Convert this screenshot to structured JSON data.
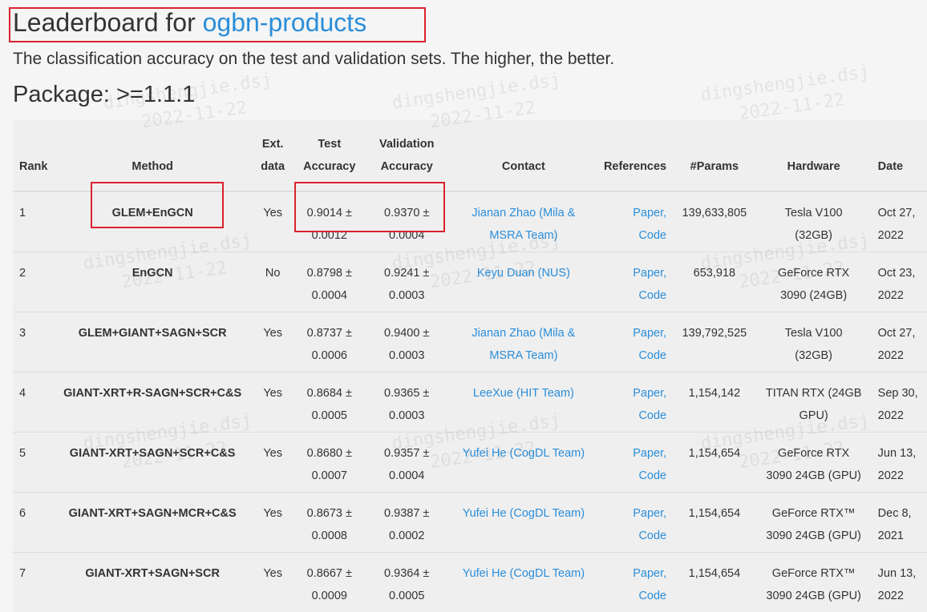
{
  "header": {
    "title_prefix": "Leaderboard for ",
    "title_link": "ogbn-products",
    "subtitle": "The classification accuracy on the test and validation sets. The higher, the better.",
    "package": "Package: >=1.1.1"
  },
  "watermark": {
    "line1": "dingshengjie.dsj",
    "line2": "2022-11-22"
  },
  "table": {
    "columns": {
      "rank": "Rank",
      "method": "Method",
      "ext_line1": "Ext.",
      "ext_line2": "data",
      "test_line1": "Test",
      "test_line2": "Accuracy",
      "val_line1": "Validation",
      "val_line2": "Accuracy",
      "contact": "Contact",
      "references": "References",
      "params": "#Params",
      "hardware": "Hardware",
      "date": "Date"
    },
    "rows": [
      {
        "rank": "1",
        "method": "GLEM+EnGCN",
        "ext": "Yes",
        "test_a": "0.9014 ±",
        "test_b": "0.0012",
        "val_a": "0.9370 ±",
        "val_b": "0.0004",
        "contact_a": "Jianan Zhao (Mila &",
        "contact_b": "MSRA Team)",
        "ref_paper": "Paper,",
        "ref_code": "Code",
        "params": "139,633,805",
        "hw_a": "Tesla V100",
        "hw_b": "(32GB)",
        "date_a": "Oct 27,",
        "date_b": "2022"
      },
      {
        "rank": "2",
        "method": "EnGCN",
        "ext": "No",
        "test_a": "0.8798 ±",
        "test_b": "0.0004",
        "val_a": "0.9241 ±",
        "val_b": "0.0003",
        "contact_a": "Keyu Duan (NUS)",
        "contact_b": "",
        "ref_paper": "Paper,",
        "ref_code": "Code",
        "params": "653,918",
        "hw_a": "GeForce RTX",
        "hw_b": "3090 (24GB)",
        "date_a": "Oct 23,",
        "date_b": "2022"
      },
      {
        "rank": "3",
        "method": "GLEM+GIANT+SAGN+SCR",
        "ext": "Yes",
        "test_a": "0.8737 ±",
        "test_b": "0.0006",
        "val_a": "0.9400 ±",
        "val_b": "0.0003",
        "contact_a": "Jianan Zhao (Mila &",
        "contact_b": "MSRA Team)",
        "ref_paper": "Paper,",
        "ref_code": "Code",
        "params": "139,792,525",
        "hw_a": "Tesla V100",
        "hw_b": "(32GB)",
        "date_a": "Oct 27,",
        "date_b": "2022"
      },
      {
        "rank": "4",
        "method": "GIANT-XRT+R-SAGN+SCR+C&S",
        "ext": "Yes",
        "test_a": "0.8684 ±",
        "test_b": "0.0005",
        "val_a": "0.9365 ±",
        "val_b": "0.0003",
        "contact_a": "LeeXue (HIT Team)",
        "contact_b": "",
        "ref_paper": "Paper,",
        "ref_code": "Code",
        "params": "1,154,142",
        "hw_a": "TITAN RTX (24GB",
        "hw_b": "GPU)",
        "date_a": "Sep 30,",
        "date_b": "2022"
      },
      {
        "rank": "5",
        "method": "GIANT-XRT+SAGN+SCR+C&S",
        "ext": "Yes",
        "test_a": "0.8680 ±",
        "test_b": "0.0007",
        "val_a": "0.9357 ±",
        "val_b": "0.0004",
        "contact_a": "Yufei He (CogDL Team)",
        "contact_b": "",
        "ref_paper": "Paper,",
        "ref_code": "Code",
        "params": "1,154,654",
        "hw_a": "GeForce RTX",
        "hw_b": "3090 24GB (GPU)",
        "date_a": "Jun 13,",
        "date_b": "2022"
      },
      {
        "rank": "6",
        "method": "GIANT-XRT+SAGN+MCR+C&S",
        "ext": "Yes",
        "test_a": "0.8673 ±",
        "test_b": "0.0008",
        "val_a": "0.9387 ±",
        "val_b": "0.0002",
        "contact_a": "Yufei He (CogDL Team)",
        "contact_b": "",
        "ref_paper": "Paper,",
        "ref_code": "Code",
        "params": "1,154,654",
        "hw_a": "GeForce RTX™",
        "hw_b": "3090 24GB (GPU)",
        "date_a": "Dec 8,",
        "date_b": "2021"
      },
      {
        "rank": "7",
        "method": "GIANT-XRT+SAGN+SCR",
        "ext": "Yes",
        "test_a": "0.8667 ±",
        "test_b": "0.0009",
        "val_a": "0.9364 ±",
        "val_b": "0.0005",
        "contact_a": "Yufei He (CogDL Team)",
        "contact_b": "",
        "ref_paper": "Paper,",
        "ref_code": "Code",
        "params": "1,154,654",
        "hw_a": "GeForce RTX™",
        "hw_b": "3090 24GB (GPU)",
        "date_a": "Jun 13,",
        "date_b": "2022"
      }
    ]
  },
  "colors": {
    "link": "#2b8ed9",
    "highlight": "#d9232e"
  }
}
